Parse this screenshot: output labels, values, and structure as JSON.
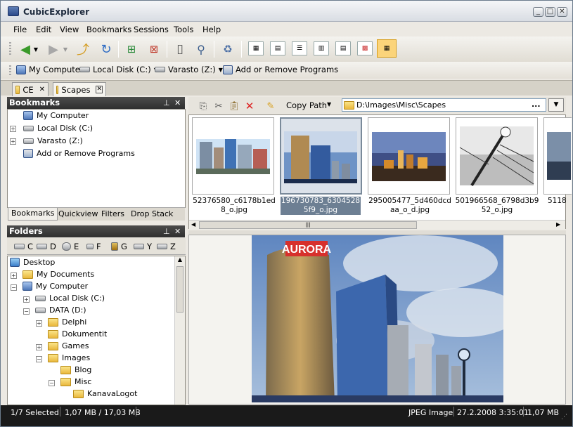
{
  "window": {
    "title": "CubicExplorer"
  },
  "menu": [
    "File",
    "Edit",
    "View",
    "Bookmarks",
    "Sessions",
    "Tools",
    "Help"
  ],
  "links": {
    "my_computer": "My Computer",
    "local_disk": "Local Disk (C:)",
    "varasto": "Varasto (Z:)",
    "add_remove": "Add or Remove Programs"
  },
  "tabs": [
    {
      "label": "CE"
    },
    {
      "label": "Scapes"
    }
  ],
  "bookmarks": {
    "title": "Bookmarks",
    "items": [
      "My Computer",
      "Local Disk (C:)",
      "Varasto (Z:)",
      "Add or Remove Programs"
    ],
    "subtabs": [
      "Bookmarks",
      "Quickview",
      "Filters",
      "Drop Stack"
    ]
  },
  "folders": {
    "title": "Folders",
    "drives": [
      "C",
      "D",
      "E",
      "F",
      "G",
      "Y",
      "Z"
    ],
    "tree": [
      "Desktop",
      "My Documents",
      "My Computer",
      "Local Disk (C:)",
      "DATA (D:)",
      "Delphi",
      "Dokumentit",
      "Games",
      "Images",
      "Blog",
      "Misc",
      "KanavaLogot"
    ]
  },
  "filetoolbar": {
    "copy_path": "Copy Path",
    "path": "D:\\Images\\Misc\\Scapes",
    "go": "..."
  },
  "thumbnails": [
    {
      "name": "52376580_c6178b1ed8_o.jpg",
      "selected": false
    },
    {
      "name": "196730783_63045285f9_o.jpg",
      "selected": true
    },
    {
      "name": "295005477_5d460dcdaa_o_d.jpg",
      "selected": false
    },
    {
      "name": "501966568_6798d3b952_o.jpg",
      "selected": false
    },
    {
      "name": "5118",
      "selected": false
    }
  ],
  "preview": {
    "sign": "AURORA"
  },
  "status": {
    "selected": "1/7 Selected",
    "sizes": "1,07 MB / 17,03 MB",
    "type": "JPEG Image",
    "date": "27.2.2008 3:35:01",
    "size": "1,07 MB"
  }
}
